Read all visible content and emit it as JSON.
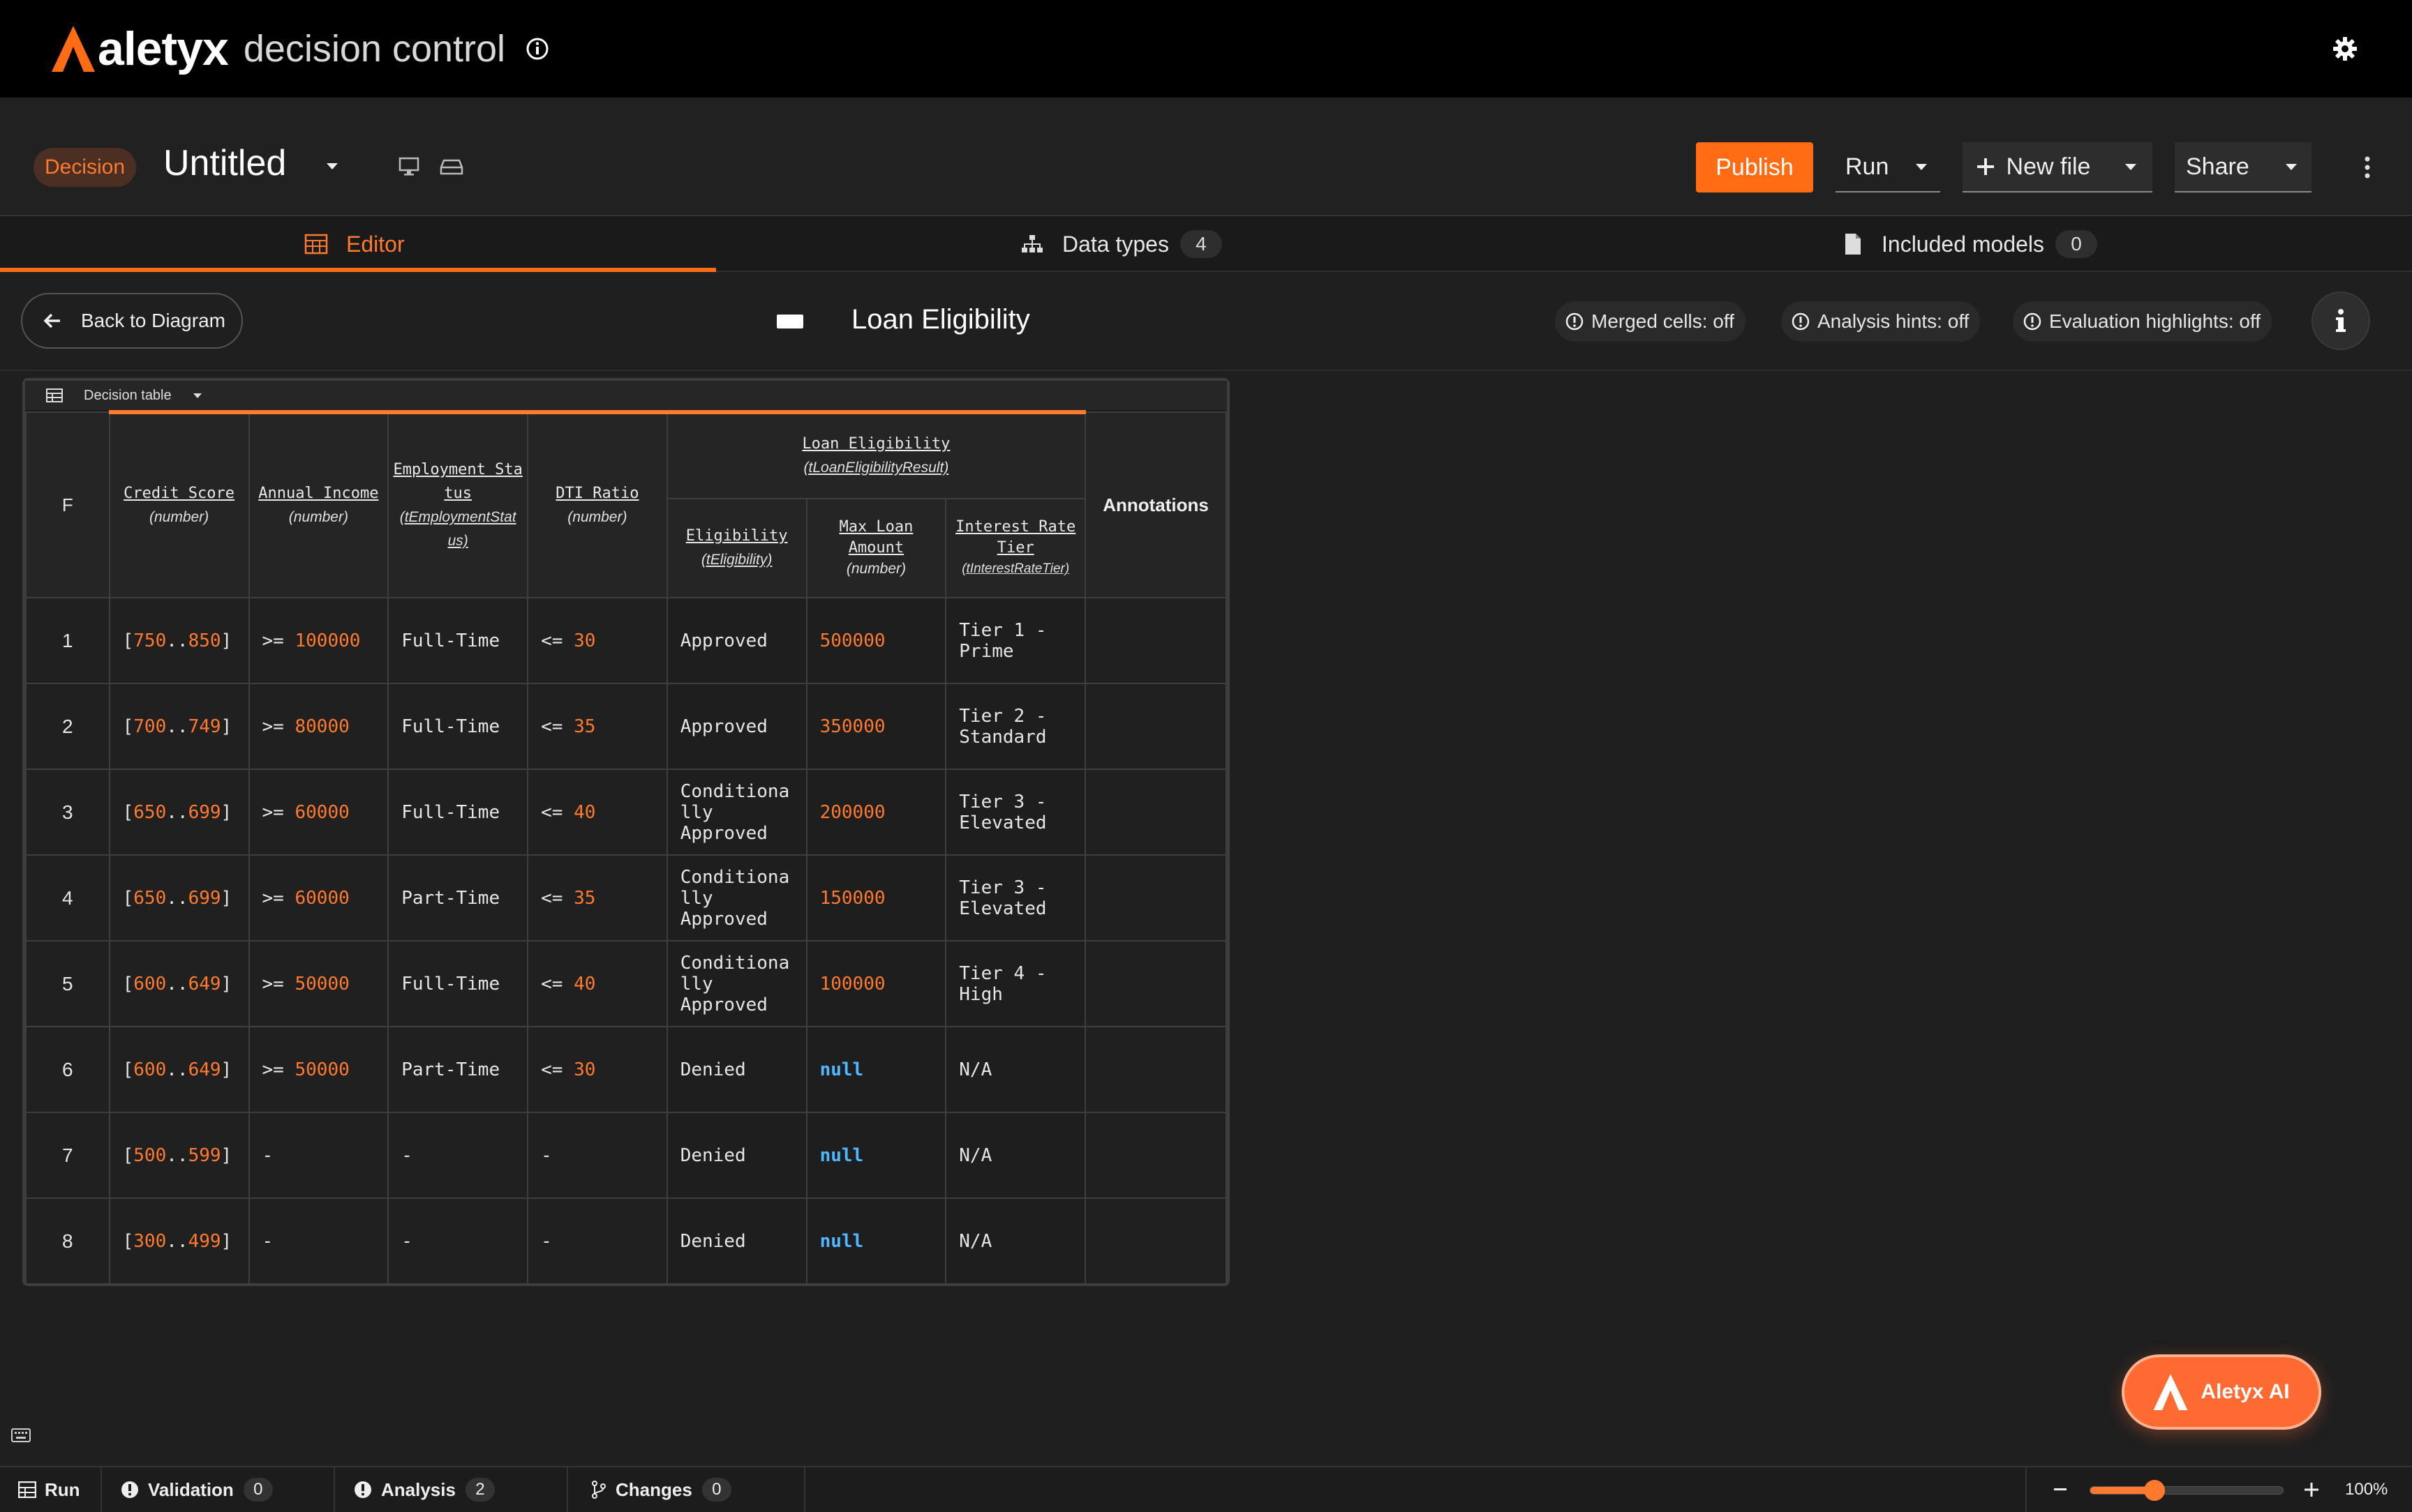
{
  "app": {
    "brand_name": "aletyx",
    "brand_sub": "decision control"
  },
  "header": {
    "badge": "Decision",
    "title": "Untitled",
    "publish": "Publish",
    "run": "Run",
    "new_file": "New file",
    "share": "Share"
  },
  "tabs": [
    {
      "label": "Editor",
      "active": true
    },
    {
      "label": "Data types",
      "count": "4"
    },
    {
      "label": "Included models",
      "count": "0"
    }
  ],
  "toolbar": {
    "back": "Back to Diagram",
    "node_title": "Loan Eligibility",
    "merged": "Merged cells: off",
    "hints": "Analysis hints: off",
    "highlights": "Evaluation highlights: off"
  },
  "table": {
    "type_label": "Decision table",
    "hit_policy": "F",
    "output_group": {
      "name": "Loan Eligibility",
      "type": "(tLoanEligibilityResult)"
    },
    "inputs": [
      {
        "name": "Credit Score",
        "type": "(number)"
      },
      {
        "name": "Annual Income",
        "type": "(number)"
      },
      {
        "name_lines": [
          "Employment Sta",
          "tus"
        ],
        "type_lines": [
          "(tEmploymentStat",
          "us)"
        ]
      },
      {
        "name": "DTI Ratio",
        "type": "(number)"
      }
    ],
    "outputs": [
      {
        "name": "Eligibility",
        "type": "(tEligibility)"
      },
      {
        "name_lines": [
          "Max Loan",
          "Amount"
        ],
        "type": "(number)"
      },
      {
        "name_lines": [
          "Interest Rate",
          "Tier"
        ],
        "type": "(tInterestRateTier)"
      }
    ],
    "annotations_header": "Annotations",
    "rows": [
      {
        "n": "1",
        "credit": [
          "750",
          "850"
        ],
        "income_op": ">= ",
        "income": "100000",
        "emp": "Full-Time",
        "dti_op": "<= ",
        "dti": "30",
        "elig": [
          "Approved"
        ],
        "amount": "500000",
        "tier": [
          "Tier 1 -",
          "Prime"
        ]
      },
      {
        "n": "2",
        "credit": [
          "700",
          "749"
        ],
        "income_op": ">= ",
        "income": "80000",
        "emp": "Full-Time",
        "dti_op": "<= ",
        "dti": "35",
        "elig": [
          "Approved"
        ],
        "amount": "350000",
        "tier": [
          "Tier 2 -",
          "Standard"
        ]
      },
      {
        "n": "3",
        "credit": [
          "650",
          "699"
        ],
        "income_op": ">= ",
        "income": "60000",
        "emp": "Full-Time",
        "dti_op": "<= ",
        "dti": "40",
        "elig": [
          "Conditiona",
          "lly",
          "Approved"
        ],
        "amount": "200000",
        "tier": [
          "Tier 3 -",
          "Elevated"
        ]
      },
      {
        "n": "4",
        "credit": [
          "650",
          "699"
        ],
        "income_op": ">= ",
        "income": "60000",
        "emp": "Part-Time",
        "dti_op": "<= ",
        "dti": "35",
        "elig": [
          "Conditiona",
          "lly",
          "Approved"
        ],
        "amount": "150000",
        "tier": [
          "Tier 3 -",
          "Elevated"
        ]
      },
      {
        "n": "5",
        "credit": [
          "600",
          "649"
        ],
        "income_op": ">= ",
        "income": "50000",
        "emp": "Full-Time",
        "dti_op": "<= ",
        "dti": "40",
        "elig": [
          "Conditiona",
          "lly",
          "Approved"
        ],
        "amount": "100000",
        "tier": [
          "Tier 4 -",
          "High"
        ]
      },
      {
        "n": "6",
        "credit": [
          "600",
          "649"
        ],
        "income_op": ">= ",
        "income": "50000",
        "emp": "Part-Time",
        "dti_op": "<= ",
        "dti": "30",
        "elig": [
          "Denied"
        ],
        "amount": null,
        "tier": [
          "N/A"
        ]
      },
      {
        "n": "7",
        "credit": [
          "500",
          "599"
        ],
        "income_op": "-",
        "income": "",
        "emp": "-",
        "dti_op": "-",
        "dti": "",
        "elig": [
          "Denied"
        ],
        "amount": null,
        "tier": [
          "N/A"
        ]
      },
      {
        "n": "8",
        "credit": [
          "300",
          "499"
        ],
        "income_op": "-",
        "income": "",
        "emp": "-",
        "dti_op": "-",
        "dti": "",
        "elig": [
          "Denied"
        ],
        "amount": null,
        "tier": [
          "N/A"
        ]
      }
    ],
    "null_text": "null"
  },
  "ai_button": "Aletyx AI",
  "statusbar": {
    "run": "Run",
    "validation": "Validation",
    "validation_count": "0",
    "analysis": "Analysis",
    "analysis_count": "2",
    "changes": "Changes",
    "changes_count": "0",
    "zoom_pct": "100%",
    "zoom_level": 0.33
  },
  "colors": {
    "accent": "#ff6c14",
    "null": "#4fb8ff"
  },
  "icons": [
    "logo-mark",
    "info-icon",
    "gear-icon",
    "chevron-down-icon",
    "desktop-icon",
    "drive-icon",
    "kebab-icon",
    "table-icon",
    "datatypes-icon",
    "file-icon",
    "arrow-left-icon",
    "decision-icon",
    "plus-icon",
    "keyboard-icon",
    "branch-icon"
  ]
}
